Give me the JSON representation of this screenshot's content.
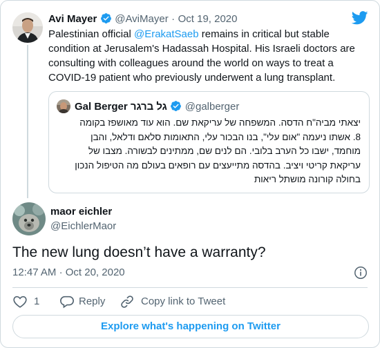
{
  "parent_tweet": {
    "author_name": "Avi Mayer",
    "handle": "@AviMayer",
    "separator": "·",
    "date": "Oct 19, 2020",
    "text_1": "Palestinian official ",
    "mention": "@ErakatSaeb",
    "text_2": " remains in critical but stable",
    "line_2": "condition at Jerusalem's Hadassah Hospital. His Israeli doctors are",
    "line_3": "consulting with colleagues around the world on ways to treat a",
    "line_4": "COVID-19 patient who previously underwent a lung transplant."
  },
  "quoted_tweet": {
    "author_name": "Gal Berger גל ברגר",
    "handle": "@galberger",
    "lines": [
      "יצאתי מביה\"ח הדסה. המשפחה של עריקאת שם. הוא עוד מאושפז בקומה",
      "8. אשתו ניעמה \"אום עלי\", בנו הבכור עלי, התאומות סלאם ודלאל, והבן",
      "מוחמד, ישבו כל הערב בלובי. הם לנים שם, ממתינים לבשורה. מצבו של",
      "עריקאת קריטי ויציב. בהדסה מתייעצים עם רופאים בעולם מה הטיפול הנכון",
      "בחולה קורונה מושתל ריאות"
    ]
  },
  "main_tweet": {
    "author_name": "maor eichler",
    "handle": "@EichlerMaor",
    "text": "The new lung doesn’t have a warranty?",
    "time": "12:47 AM",
    "separator": "·",
    "date": "Oct 20, 2020"
  },
  "actions": {
    "like_count": "1",
    "reply_label": "Reply",
    "copy_label": "Copy link to Tweet"
  },
  "explore_label": "Explore what's happening on Twitter",
  "colors": {
    "accent": "#1d9bf0",
    "like_red": "#f4212e",
    "border": "#cfd9de",
    "secondary": "#536471"
  }
}
